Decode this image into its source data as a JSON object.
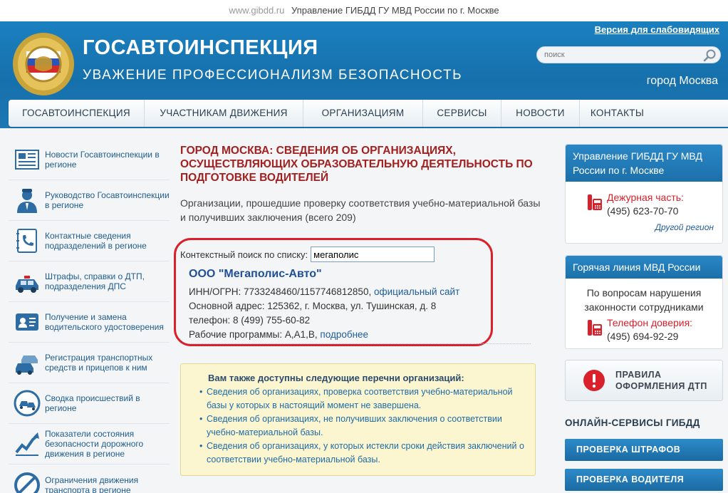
{
  "topline": {
    "site": "www.gibdd.ru",
    "title": "Управление ГИБДД ГУ МВД России по г. Москве"
  },
  "header": {
    "title": "ГОСАВТОИНСПЕКЦИЯ",
    "slogan": "УВАЖЕНИЕ  ПРОФЕССИОНАЛИЗМ  БЕЗОПАСНОСТЬ",
    "low_vision_link": "Версия для слабовидящих",
    "search_placeholder": "поиск",
    "city": "город Москва"
  },
  "nav": [
    {
      "label": "ГОСАВТОИНСПЕКЦИЯ"
    },
    {
      "label": "УЧАСТНИКАМ ДВИЖЕНИЯ"
    },
    {
      "label": "ОРГАНИЗАЦИЯМ"
    },
    {
      "label": "СЕРВИСЫ"
    },
    {
      "label": "НОВОСТИ"
    },
    {
      "label": "КОНТАКТЫ"
    }
  ],
  "sidebar": {
    "items": [
      {
        "label": "Новости Госавтоинспекции в регионе",
        "icon": "newspaper-icon"
      },
      {
        "label": "Руководство Госавтоинспекции в регионе",
        "icon": "officer-icon"
      },
      {
        "label": "Контактные сведения подразделений в регионе",
        "icon": "phonebook-icon"
      },
      {
        "label": "Штрафы, справки о ДТП, подразделения ДПС",
        "icon": "police-car-icon"
      },
      {
        "label": "Получение и замена водительского удостоверения",
        "icon": "license-card-icon"
      },
      {
        "label": "Регистрация транспортных средств и прицепов к ним",
        "icon": "cars-icon"
      },
      {
        "label": "Сводка происшествий в регионе",
        "icon": "crash-icon"
      },
      {
        "label": "Показатели состояния безопасности дорожного движения в регионе",
        "icon": "chart-icon"
      },
      {
        "label": "Ограничения движения транспорта в регионе",
        "icon": "no-entry-icon"
      }
    ]
  },
  "main": {
    "heading": "ГОРОД МОСКВА: СВЕДЕНИЯ ОБ ОРГАНИЗАЦИЯХ, ОСУЩЕСТВЛЯЮЩИХ ОБРАЗОВАТЕЛЬНУЮ ДЕЯТЕЛЬНОСТЬ ПО ПОДГОТОВКЕ ВОДИТЕЛЕЙ",
    "intro": "Организации, прошедшие проверку соответствия учебно-материальной базы и получивших заключения (всего 209)",
    "search_label": "Контекстный поиск по списку:",
    "search_value": "мегаполис",
    "org": {
      "name": "ООО \"Мегаполис-Авто\"",
      "inn_label": "ИНН/ОГРН: 7733248460/1157746812850,",
      "site_link": "официальный сайт",
      "address": "Основной адрес: 125362, г. Москва, ул. Тушинская, д. 8",
      "phone": "телефон: 8 (499) 755-60-82",
      "programs_label": "Рабочие программы: А,А1,В,",
      "more_link": "подробнее"
    },
    "note": {
      "title": "Вам также доступны следующие перечни организаций:",
      "items": [
        {
          "text": "Сведения об организациях, проверка соответствия учебно-материальной базы у которых в настоящий момент не завершена."
        },
        {
          "text": "Сведения об организациях, не получивших заключения о соответствии учебно-материальной базы."
        },
        {
          "text": "Сведения об организациях, у которых истекли сроки действия заключений о соответствии учебно-материальной базы."
        }
      ]
    }
  },
  "right": {
    "gibdd_card": {
      "title": "Управление ГИБДД ГУ МВД России по г. Москве",
      "duty_label": "Дежурная часть:",
      "duty_phone": "(495) 623-70-70",
      "other_region": "Другой регион"
    },
    "hotline_card": {
      "title": "Горячая линия МВД России",
      "text": "По вопросам нарушения законности сотрудниками",
      "trust_label": "Телефон доверия:",
      "trust_phone": "(495) 694-92-29"
    },
    "rules_button": {
      "line1": "ПРАВИЛА",
      "line2": "ОФОРМЛЕНИЯ ДТП"
    },
    "online_title": "ОНЛАЙН-СЕРВИСЫ ГИБДД",
    "services": [
      {
        "label": "ПРОВЕРКА ШТРАФОВ"
      },
      {
        "label": "ПРОВЕРКА ВОДИТЕЛЯ"
      }
    ]
  },
  "colors": {
    "header_blue": "#1670ab",
    "heading_red": "#a32020",
    "link_blue": "#1f5c99",
    "ring_red": "#d9202b",
    "note_bg": "#fbf6d0"
  }
}
